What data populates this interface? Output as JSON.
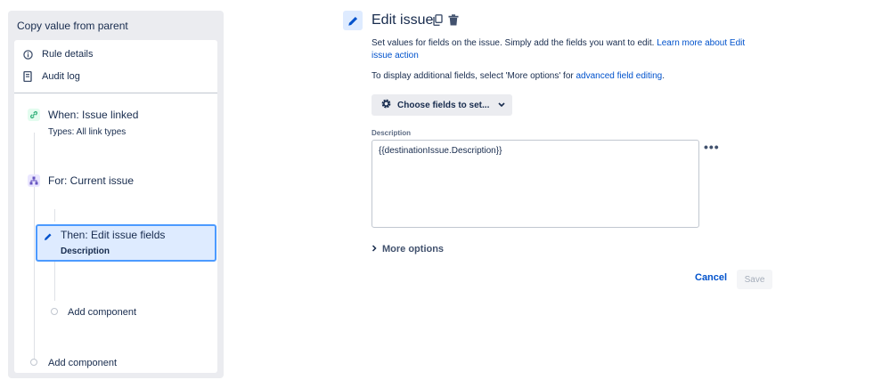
{
  "sidebar": {
    "title": "Copy value from parent",
    "links": [
      {
        "label": "Rule details",
        "icon": "info-icon"
      },
      {
        "label": "Audit log",
        "icon": "document-icon"
      }
    ],
    "trigger": {
      "title": "When: Issue linked",
      "subtitle": "Types: All link types",
      "icon": "link-icon",
      "color": "#e3fcef",
      "icon_color": "#36b37e"
    },
    "branch": {
      "title": "For: Current issue",
      "icon": "hierarchy-icon",
      "color": "#eae6ff",
      "icon_color": "#6554c0"
    },
    "action": {
      "title": "Then: Edit issue fields",
      "subtitle": "Description",
      "icon": "pencil-icon"
    },
    "add_component_inner": "Add component",
    "add_component_outer": "Add component"
  },
  "main": {
    "title": "Edit issue",
    "description_text": "Set values for fields on the issue. Simply add the fields you want to edit. ",
    "description_link": "Learn more about Edit issue action",
    "display_text": "To display additional fields, select 'More options' for ",
    "display_link": "advanced field editing",
    "display_end": ".",
    "choose_button": "Choose fields to set...",
    "field_label": "Description",
    "field_value": "{{destinationIssue.Description}}",
    "field_more": "•••",
    "more_options": "More options",
    "cancel": "Cancel",
    "save": "Save",
    "accent": "#0052cc"
  }
}
